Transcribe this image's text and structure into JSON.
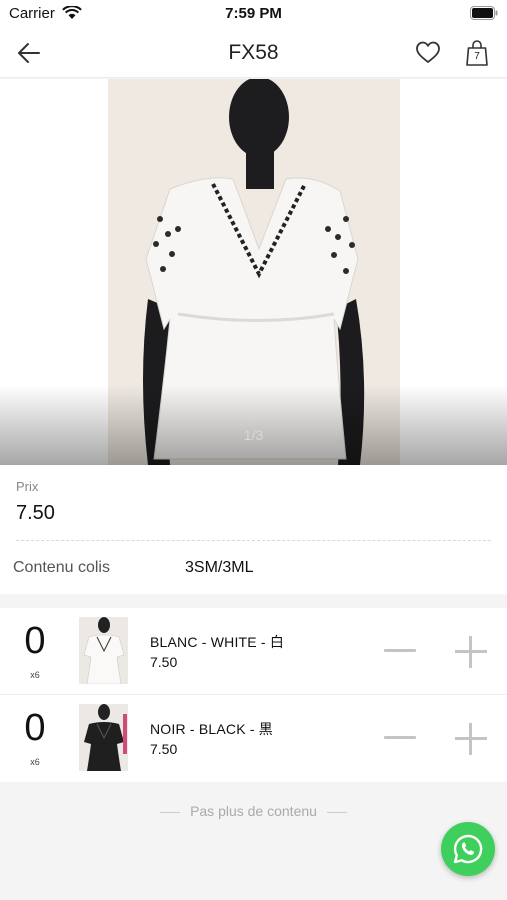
{
  "status_bar": {
    "carrier": "Carrier",
    "time": "7:59 PM"
  },
  "nav": {
    "title": "FX58",
    "bag_count": "7"
  },
  "gallery": {
    "counter": "1/3"
  },
  "product": {
    "price_label": "Prix",
    "price_value": "7.50",
    "contenu_label": "Contenu colis",
    "contenu_value": "3SM/3ML"
  },
  "variants": [
    {
      "qty": "0",
      "multiplier": "x6",
      "name": "BLANC - WHITE - 白",
      "price": "7.50",
      "swatch": "white"
    },
    {
      "qty": "0",
      "multiplier": "x6",
      "name": "NOIR - BLACK - 黒",
      "price": "7.50",
      "swatch": "black"
    }
  ],
  "footer": {
    "note": "Pas plus de contenu"
  },
  "colors": {
    "whatsapp": "#3fcf5c",
    "stepper": "#c4c4c4"
  }
}
